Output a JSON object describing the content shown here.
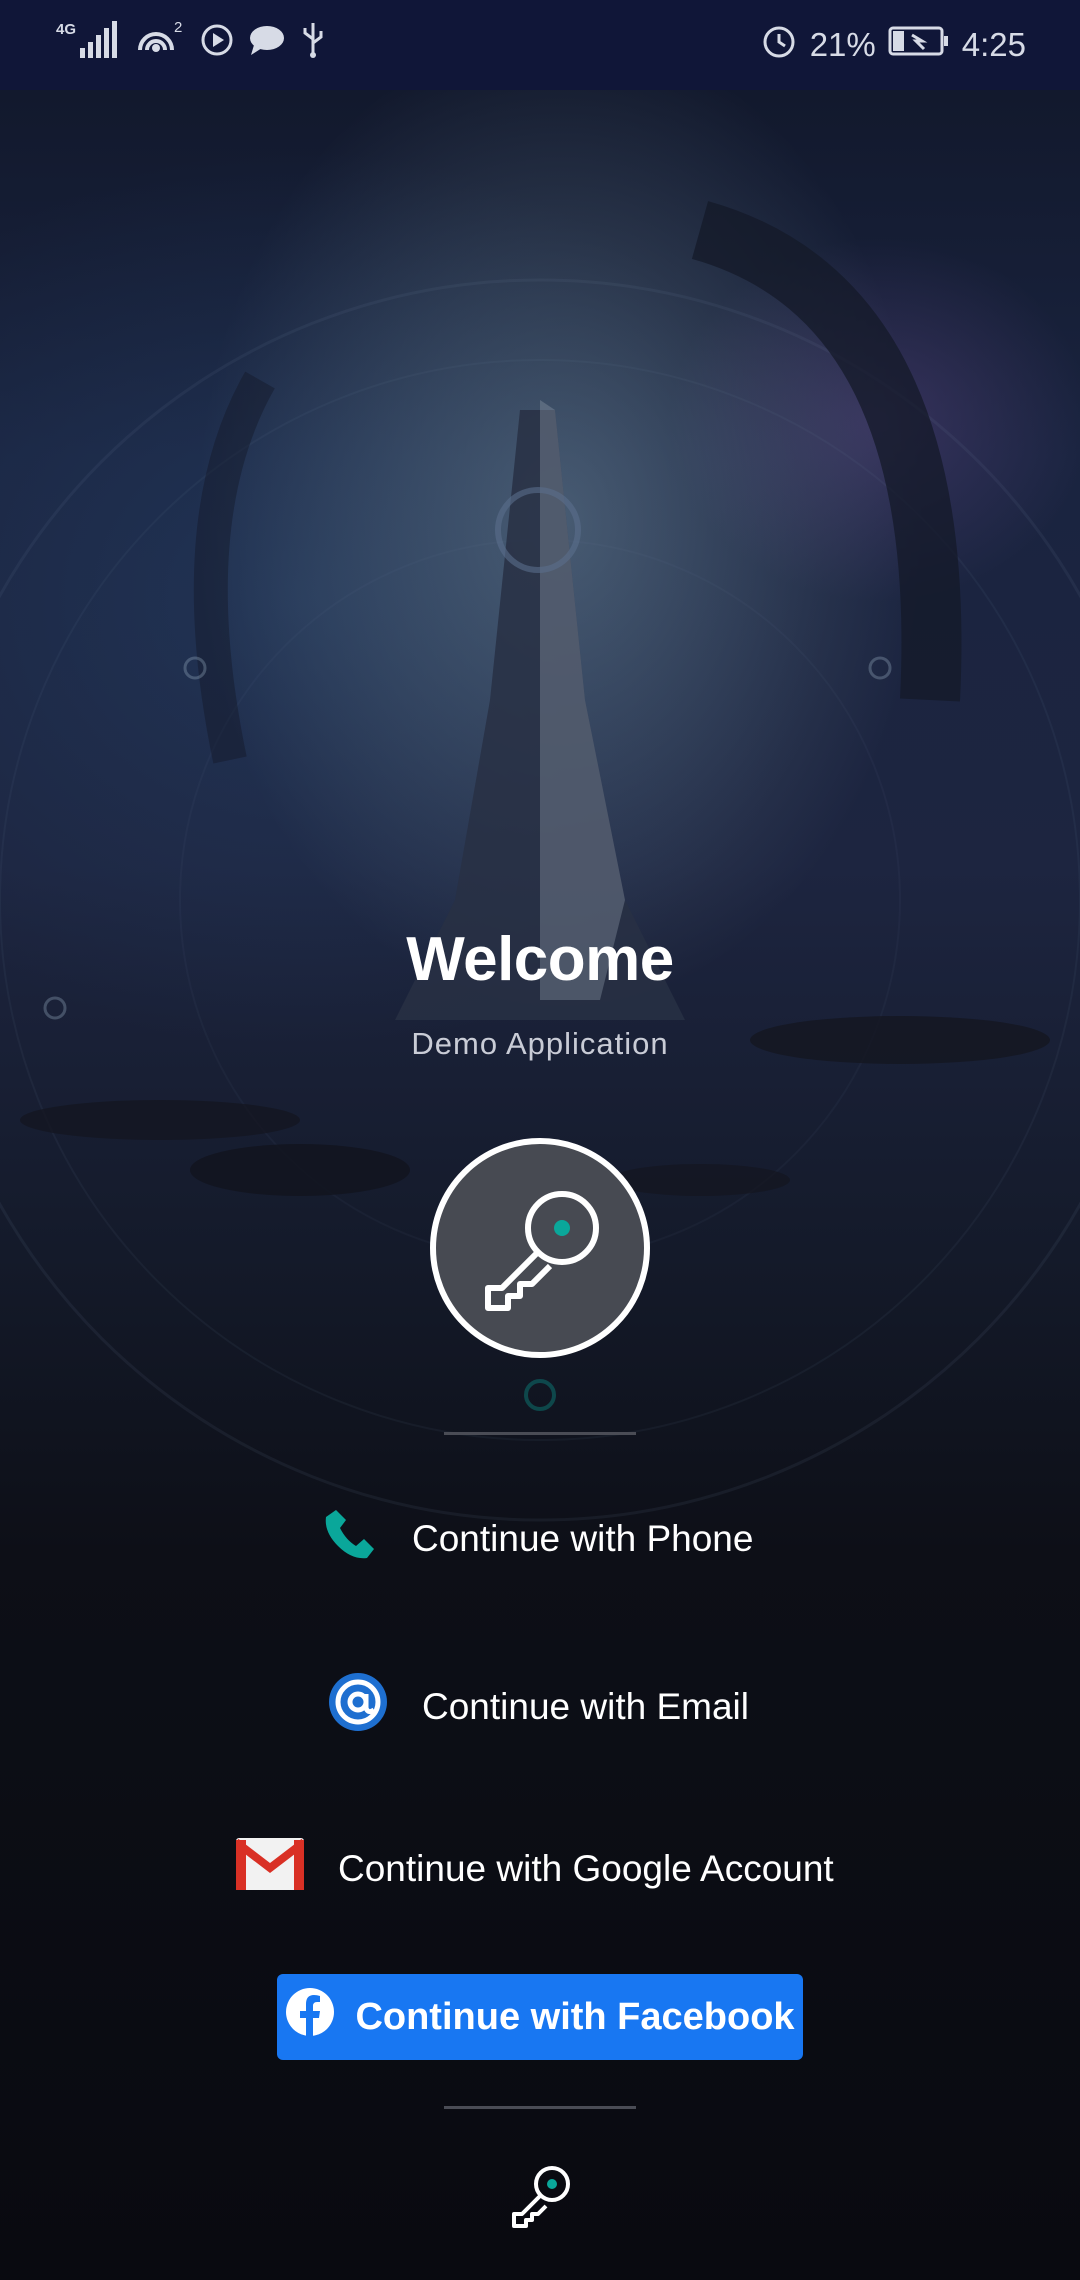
{
  "status_bar": {
    "network": "4G",
    "hotspot_count": "2",
    "battery": "21%",
    "time": "4:25"
  },
  "welcome": {
    "title": "Welcome",
    "subtitle": "Demo Application"
  },
  "login_options": {
    "phone": "Continue with Phone",
    "email": "Continue with Email",
    "google": "Continue with Google Account",
    "facebook": "Continue with Facebook"
  },
  "icons": {
    "logo": "key-icon",
    "phone": "phone-icon",
    "email": "at-sign-icon",
    "google": "gmail-icon",
    "facebook": "facebook-icon",
    "bottom": "key-icon"
  },
  "colors": {
    "accent_teal": "#0aa79a",
    "facebook_blue": "#1877f2",
    "email_blue": "#1e6fd0",
    "gmail_red": "#d93025"
  }
}
